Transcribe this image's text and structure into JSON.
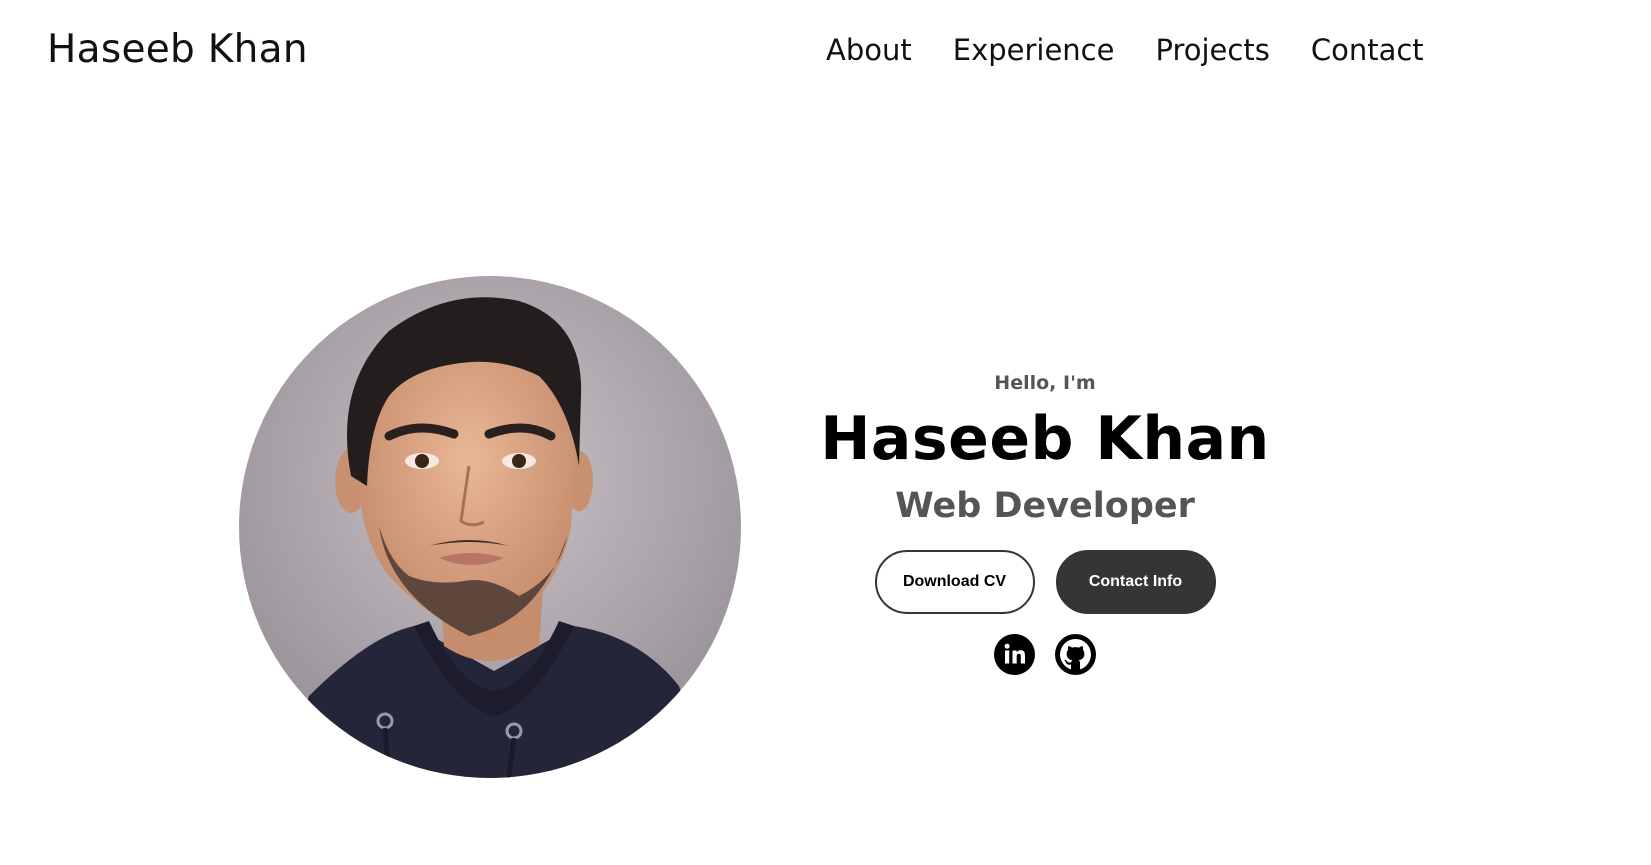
{
  "header": {
    "logo": "Haseeb Khan",
    "nav": [
      {
        "label": "About"
      },
      {
        "label": "Experience"
      },
      {
        "label": "Projects"
      },
      {
        "label": "Contact"
      }
    ]
  },
  "hero": {
    "greeting": "Hello, I'm",
    "name": "Haseeb Khan",
    "title": "Web Developer",
    "buttons": {
      "download": "Download CV",
      "contact": "Contact Info"
    },
    "socials": [
      {
        "icon": "linkedin-icon"
      },
      {
        "icon": "github-icon"
      }
    ]
  },
  "colors": {
    "text": "#000000",
    "muted": "#555555",
    "button_dark": "#353535",
    "background": "#ffffff"
  }
}
